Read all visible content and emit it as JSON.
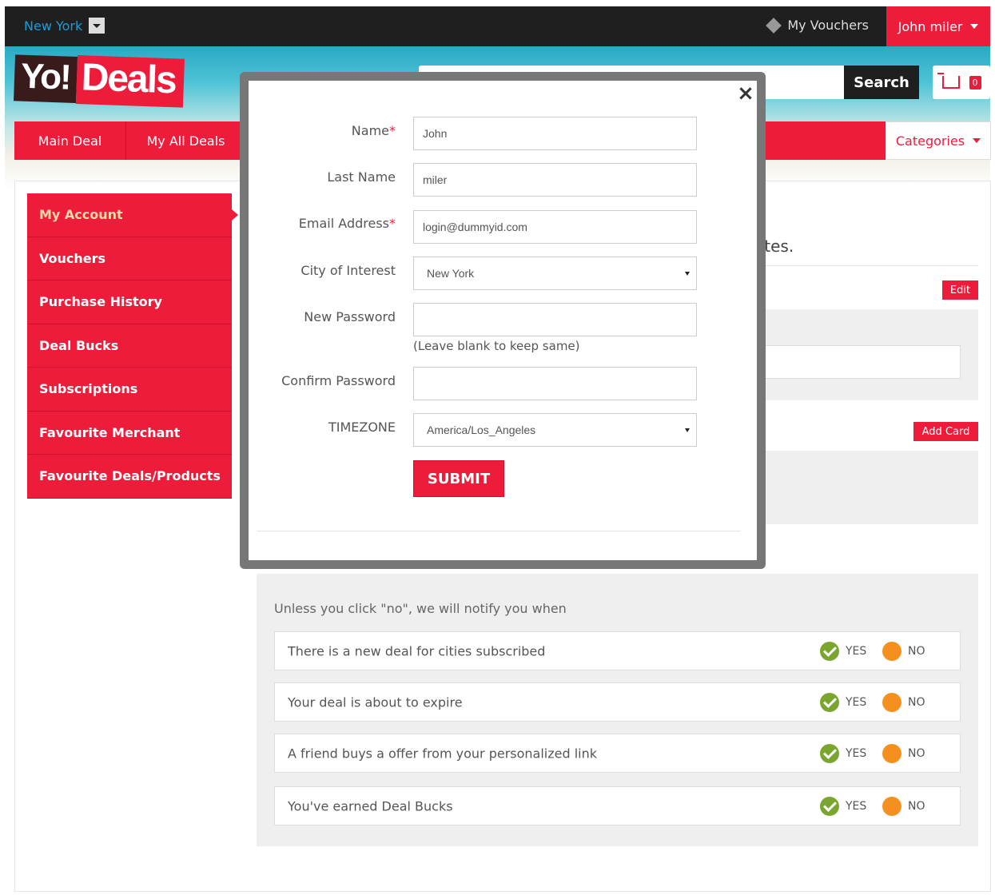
{
  "topbar": {
    "city": "New York",
    "vouchers_label": "My Vouchers",
    "user_name": "John miler"
  },
  "header": {
    "logo_part1": "Yo!",
    "logo_part2": "Deals",
    "search_button": "Search",
    "cart_count": "0"
  },
  "nav": {
    "items": [
      "Main Deal",
      "My All Deals"
    ],
    "categories_label": "Categories"
  },
  "sidebar": {
    "items": [
      "My Account",
      "Vouchers",
      "Purchase History",
      "Deal Bucks",
      "Subscriptions",
      "Favourite Merchant",
      "Favourite Deals/Products"
    ]
  },
  "background": {
    "heading_fragment": "ates.",
    "edit_label": "Edit",
    "add_card_label": "Add Card"
  },
  "modal": {
    "name_label": "Name",
    "name_value": "John",
    "last_name_label": "Last Name",
    "last_name_value": "miler",
    "email_label": "Email Address",
    "email_value": "login@dummyid.com",
    "city_label": "City of Interest",
    "city_value": "New York",
    "new_password_label": "New Password",
    "new_password_hint": "(Leave blank to keep same)",
    "confirm_password_label": "Confirm Password",
    "timezone_label": "TIMEZONE",
    "timezone_value": "America/Los_Angeles",
    "submit_label": "SUBMIT",
    "required_marker": "*",
    "close_glyph": "×"
  },
  "notifications": {
    "heading": "Unless you click \"no\", we will notify you when",
    "yes_label": "YES",
    "no_label": "NO",
    "rows": [
      "There is a new deal for cities subscribed",
      "Your deal is about to expire",
      "A friend buys a offer from your personalized link",
      "You've earned Deal Bucks"
    ]
  },
  "colors": {
    "brand_red": "#ee1c3b",
    "dark_bar": "#1f1f1f",
    "yes_green": "#7aa630",
    "no_orange": "#f5901f"
  }
}
